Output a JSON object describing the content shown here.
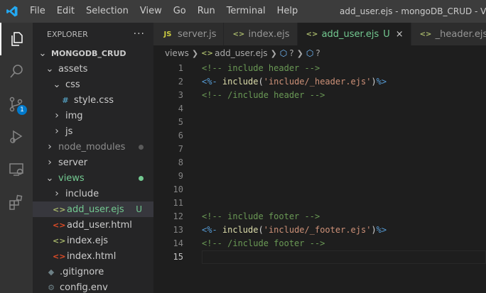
{
  "titlebar": {
    "menu": [
      "File",
      "Edit",
      "Selection",
      "View",
      "Go",
      "Run",
      "Terminal",
      "Help"
    ],
    "window_title": "add_user.ejs - mongoDB_CRUD - Visual Studio Code"
  },
  "activitybar": {
    "items": [
      "explorer-icon",
      "search-icon",
      "source-control-icon",
      "run-debug-icon",
      "remote-explorer-icon",
      "extensions-icon"
    ],
    "source_control_badge": "1"
  },
  "sidebar": {
    "title": "EXPLORER",
    "more": "···",
    "tree": [
      {
        "label": "MONGODB_CRUD",
        "type": "folder-open",
        "depth": 0,
        "bold": true
      },
      {
        "label": "assets",
        "type": "folder-open",
        "depth": 1
      },
      {
        "label": "css",
        "type": "folder-open",
        "depth": 2
      },
      {
        "label": "style.css",
        "type": "css",
        "depth": 3,
        "icon_text": "#"
      },
      {
        "label": "img",
        "type": "folder",
        "depth": 2
      },
      {
        "label": "js",
        "type": "folder",
        "depth": 2
      },
      {
        "label": "node_modules",
        "type": "folder",
        "depth": 1,
        "dim": true
      },
      {
        "label": "server",
        "type": "folder",
        "depth": 1
      },
      {
        "label": "views",
        "type": "folder-open",
        "depth": 1,
        "green": true
      },
      {
        "label": "include",
        "type": "folder",
        "depth": 2
      },
      {
        "label": "add_user.ejs",
        "type": "ejs",
        "depth": 2,
        "green": true,
        "status": "U",
        "selected": true,
        "icon_text": "<>"
      },
      {
        "label": "add_user.html",
        "type": "html",
        "depth": 2,
        "icon_text": "<>"
      },
      {
        "label": "index.ejs",
        "type": "ejs",
        "depth": 2,
        "icon_text": "<>"
      },
      {
        "label": "index.html",
        "type": "html",
        "depth": 2,
        "icon_text": "<>"
      },
      {
        "label": ".gitignore",
        "type": "gitignore",
        "depth": 1,
        "icon_text": "◆"
      },
      {
        "label": "config.env",
        "type": "env",
        "depth": 1,
        "icon_text": "⚙"
      }
    ]
  },
  "tabs": [
    {
      "label": "server.js",
      "icon_text": "JS",
      "active": false
    },
    {
      "label": "index.ejs",
      "icon_text": "<>",
      "active": false
    },
    {
      "label": "add_user.ejs",
      "icon_text": "<>",
      "active": true,
      "status": "U",
      "close": "×"
    },
    {
      "label": "_header.ejs",
      "icon_text": "<>",
      "active": false
    }
  ],
  "breadcrumb": {
    "folder": "views",
    "file": "add_user.ejs",
    "sym1": "?",
    "sym2": "?"
  },
  "editor": {
    "current_line": 15,
    "lines": [
      {
        "n": "1",
        "tokens": [
          {
            "t": "<!-- include header -->",
            "c": "c-comment"
          }
        ]
      },
      {
        "n": "2",
        "tokens": [
          {
            "t": "<%- ",
            "c": "c-ejs"
          },
          {
            "t": "include",
            "c": "c-kw"
          },
          {
            "t": "(",
            "c": "c-txt"
          },
          {
            "t": "'include/_header.ejs'",
            "c": "c-str"
          },
          {
            "t": ")",
            "c": "c-txt"
          },
          {
            "t": "%>",
            "c": "c-ejs"
          }
        ]
      },
      {
        "n": "3",
        "tokens": [
          {
            "t": "<!-- /include header -->",
            "c": "c-comment"
          }
        ]
      },
      {
        "n": "4",
        "tokens": []
      },
      {
        "n": "5",
        "tokens": []
      },
      {
        "n": "6",
        "tokens": []
      },
      {
        "n": "7",
        "tokens": []
      },
      {
        "n": "8",
        "tokens": []
      },
      {
        "n": "9",
        "tokens": []
      },
      {
        "n": "10",
        "tokens": []
      },
      {
        "n": "11",
        "tokens": []
      },
      {
        "n": "12",
        "tokens": [
          {
            "t": "<!-- include footer -->",
            "c": "c-comment"
          }
        ]
      },
      {
        "n": "13",
        "tokens": [
          {
            "t": "<%- ",
            "c": "c-ejs"
          },
          {
            "t": "include",
            "c": "c-kw"
          },
          {
            "t": "(",
            "c": "c-txt"
          },
          {
            "t": "'include/_footer.ejs'",
            "c": "c-str"
          },
          {
            "t": ")",
            "c": "c-txt"
          },
          {
            "t": "%>",
            "c": "c-ejs"
          }
        ]
      },
      {
        "n": "14",
        "tokens": [
          {
            "t": "<!-- /include footer -->",
            "c": "c-comment"
          }
        ]
      },
      {
        "n": "15",
        "tokens": []
      }
    ]
  },
  "colors": {
    "accent": "#007acc",
    "git_untracked": "#73c991",
    "ejs_icon": "#a8b86b",
    "html_icon": "#e44d26",
    "css_icon": "#519aba",
    "js_icon": "#cbcb41"
  }
}
